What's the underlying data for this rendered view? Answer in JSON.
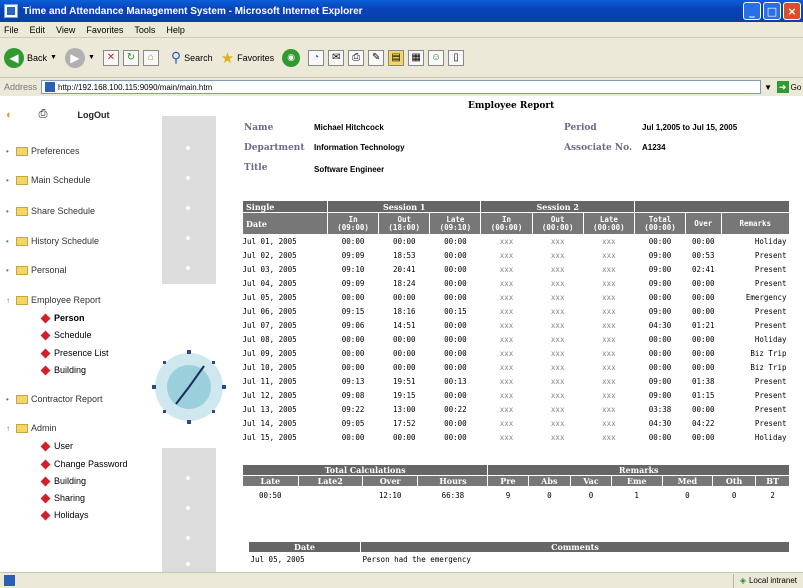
{
  "window": {
    "title": "Time and Attendance Management System - Microsoft Internet Explorer"
  },
  "menu": [
    "File",
    "Edit",
    "View",
    "Favorites",
    "Tools",
    "Help"
  ],
  "toolbar": {
    "back": "Back",
    "search": "Search",
    "favorites": "Favorites"
  },
  "address": {
    "label": "Address",
    "url": "http://192.168.100.115:9090/main/main.htm",
    "go": "Go"
  },
  "status": {
    "zone": "Local intranet"
  },
  "sidebar": {
    "logout": "LogOut",
    "items": [
      {
        "label": "Preferences"
      },
      {
        "label": "Main Schedule"
      },
      {
        "label": "Share Schedule"
      },
      {
        "label": "History Schedule"
      },
      {
        "label": "Personal"
      },
      {
        "label": "Employee Report"
      },
      {
        "label": "Contractor Report"
      },
      {
        "label": "Admin"
      }
    ],
    "employee_sub": [
      "Person",
      "Schedule",
      "Presence List",
      "Building"
    ],
    "admin_sub": [
      "User",
      "Change Password",
      "Building",
      "Sharing",
      "Holidays"
    ]
  },
  "report": {
    "title": "Employee Report",
    "name_label": "Name",
    "name": "Michael Hitchcock",
    "dept_label": "Department",
    "dept": "Information Technology",
    "title_label": "Title",
    "job_title": "Software Engineer",
    "period_label": "Period",
    "period": "Jul 1,2005 to Jul 15, 2005",
    "assoc_label": "Associate No.",
    "assoc": "A1234",
    "group_headers": [
      "Single",
      "Session 1",
      "Session 2"
    ],
    "col_headers": [
      "Date",
      "In\n(09:00)",
      "Out\n(18:00)",
      "Late\n(09:10)",
      "In\n(00:00)",
      "Out\n(00:00)",
      "Late\n(00:00)",
      "Total\n(00:00)",
      "Over",
      "Remarks"
    ],
    "rows": [
      [
        "Jul 01, 2005",
        "00:00",
        "00:00",
        "00:00",
        "xxx",
        "xxx",
        "xxx",
        "00:00",
        "00:00",
        "Holiday"
      ],
      [
        "Jul 02, 2005",
        "09:09",
        "18:53",
        "00:00",
        "xxx",
        "xxx",
        "xxx",
        "09:00",
        "00:53",
        "Present"
      ],
      [
        "Jul 03, 2005",
        "09:10",
        "20:41",
        "00:00",
        "xxx",
        "xxx",
        "xxx",
        "09:00",
        "02:41",
        "Present"
      ],
      [
        "Jul 04, 2005",
        "09:09",
        "18:24",
        "00:00",
        "xxx",
        "xxx",
        "xxx",
        "09:00",
        "00:00",
        "Present"
      ],
      [
        "Jul 05, 2005",
        "00:00",
        "00:00",
        "00:00",
        "xxx",
        "xxx",
        "xxx",
        "00:00",
        "00:00",
        "Emergency"
      ],
      [
        "Jul 06, 2005",
        "09:15",
        "18:16",
        "00:15",
        "xxx",
        "xxx",
        "xxx",
        "09:00",
        "00:00",
        "Present"
      ],
      [
        "Jul 07, 2005",
        "09:06",
        "14:51",
        "00:00",
        "xxx",
        "xxx",
        "xxx",
        "04:30",
        "01:21",
        "Present"
      ],
      [
        "Jul 08, 2005",
        "00:00",
        "00:00",
        "00:00",
        "xxx",
        "xxx",
        "xxx",
        "00:00",
        "00:00",
        "Holiday"
      ],
      [
        "Jul 09, 2005",
        "00:00",
        "00:00",
        "00:00",
        "xxx",
        "xxx",
        "xxx",
        "00:00",
        "00:00",
        "Biz Trip"
      ],
      [
        "Jul 10, 2005",
        "00:00",
        "00:00",
        "00:00",
        "xxx",
        "xxx",
        "xxx",
        "00:00",
        "00:00",
        "Biz Trip"
      ],
      [
        "Jul 11, 2005",
        "09:13",
        "19:51",
        "00:13",
        "xxx",
        "xxx",
        "xxx",
        "09:00",
        "01:38",
        "Present"
      ],
      [
        "Jul 12, 2005",
        "09:08",
        "19:15",
        "00:00",
        "xxx",
        "xxx",
        "xxx",
        "09:00",
        "01:15",
        "Present"
      ],
      [
        "Jul 13, 2005",
        "09:22",
        "13:00",
        "00:22",
        "xxx",
        "xxx",
        "xxx",
        "03:38",
        "00:00",
        "Present"
      ],
      [
        "Jul 14, 2005",
        "09:05",
        "17:52",
        "00:00",
        "xxx",
        "xxx",
        "xxx",
        "04:30",
        "04:22",
        "Present"
      ],
      [
        "Jul 15, 2005",
        "00:00",
        "00:00",
        "00:00",
        "xxx",
        "xxx",
        "xxx",
        "00:00",
        "00:00",
        "Holiday"
      ]
    ],
    "totals_header": "Total Calculations",
    "remarks_header": "Remarks",
    "totals_cols": [
      "Late",
      "Late2",
      "Over",
      "Hours",
      "Pre",
      "Abs",
      "Vac",
      "Eme",
      "Med",
      "Oth",
      "BT"
    ],
    "totals_vals": [
      "00:50",
      "",
      "12:10",
      "66:38",
      "9",
      "0",
      "0",
      "1",
      "0",
      "0",
      "2"
    ],
    "comment_cols": [
      "Date",
      "Comments"
    ],
    "comment_rows": [
      [
        "Jul 05, 2005",
        "Person had the emergency"
      ]
    ]
  }
}
